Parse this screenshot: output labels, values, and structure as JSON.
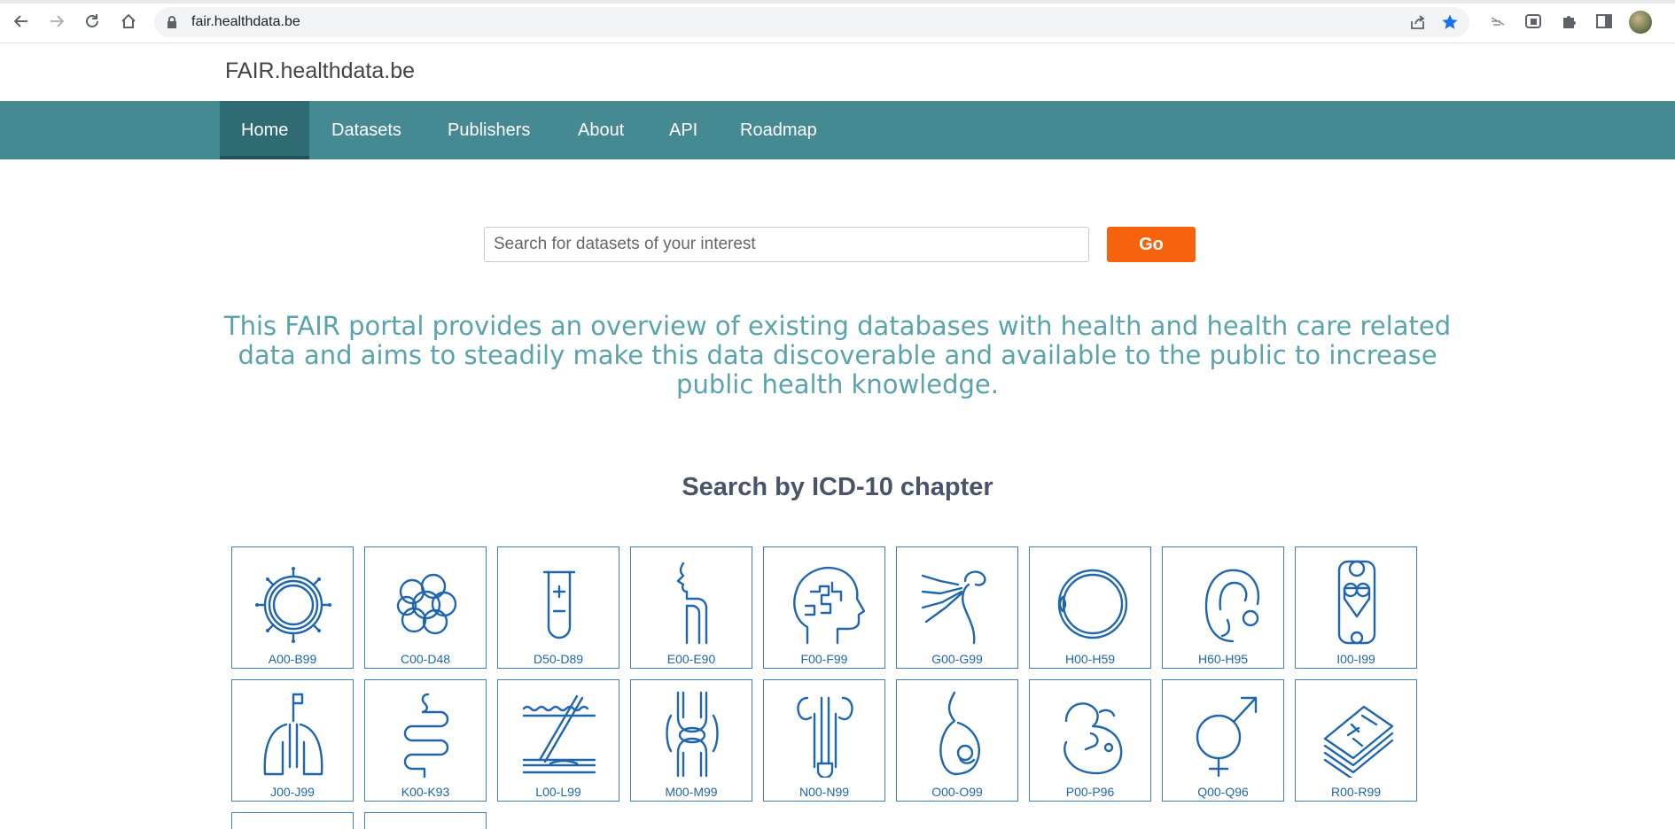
{
  "browser": {
    "url": "fair.healthdata.be"
  },
  "site": {
    "brand": "FAIR.healthdata.be",
    "nav": [
      {
        "label": "Home"
      },
      {
        "label": "Datasets"
      },
      {
        "label": "Publishers"
      },
      {
        "label": "About"
      },
      {
        "label": "API"
      },
      {
        "label": "Roadmap"
      }
    ],
    "active_nav": "Home"
  },
  "search": {
    "placeholder": "Search for datasets of your interest",
    "value": "",
    "button_label": "Go"
  },
  "intro": "This FAIR portal provides an overview of existing databases with health and health care related data and aims to steadily make this data discoverable and available to the public to increase public health knowledge.",
  "icd": {
    "title": "Search by ICD-10 chapter",
    "chapters": [
      {
        "code": "A00-B99",
        "icon": "virus-icon"
      },
      {
        "code": "C00-D48",
        "icon": "cell-cluster-icon"
      },
      {
        "code": "D50-D89",
        "icon": "test-tube-icon"
      },
      {
        "code": "E00-E90",
        "icon": "thyroid-icon"
      },
      {
        "code": "F00-F99",
        "icon": "mind-puzzle-icon"
      },
      {
        "code": "G00-G99",
        "icon": "nerve-icon"
      },
      {
        "code": "H00-H59",
        "icon": "eye-icon"
      },
      {
        "code": "H60-H95",
        "icon": "ear-icon"
      },
      {
        "code": "I00-I99",
        "icon": "heart-vessel-icon"
      },
      {
        "code": "J00-J99",
        "icon": "lungs-icon"
      },
      {
        "code": "K00-K93",
        "icon": "intestine-icon"
      },
      {
        "code": "L00-L99",
        "icon": "skin-icon"
      },
      {
        "code": "M00-M99",
        "icon": "knee-joint-icon"
      },
      {
        "code": "N00-N99",
        "icon": "kidney-icon"
      },
      {
        "code": "O00-O99",
        "icon": "pregnancy-icon"
      },
      {
        "code": "P00-P96",
        "icon": "fetus-icon"
      },
      {
        "code": "Q00-Q96",
        "icon": "gender-symbol-icon"
      },
      {
        "code": "R00-R99",
        "icon": "medical-records-icon"
      }
    ]
  },
  "colors": {
    "nav_bg": "#458a93",
    "nav_active": "#2e6b73",
    "go_button": "#f7630c",
    "intro_text": "#5aa3ad",
    "icon_stroke": "#1f66ac"
  }
}
